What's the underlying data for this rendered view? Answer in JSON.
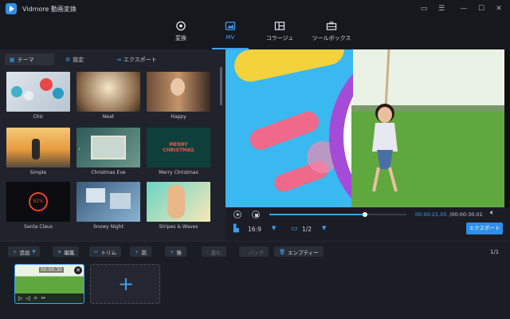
{
  "app": {
    "title": "Vidmore 動画変換"
  },
  "nav": [
    {
      "label": "変換",
      "icon": "convert-icon",
      "active": false
    },
    {
      "label": "MV",
      "icon": "mv-icon",
      "active": true
    },
    {
      "label": "コラージュ",
      "icon": "collage-icon",
      "active": false
    },
    {
      "label": "ツールボックス",
      "icon": "toolbox-icon",
      "active": false
    }
  ],
  "subtabs": [
    {
      "label": "テーマ",
      "icon": "grid-icon",
      "active": true
    },
    {
      "label": "設定",
      "icon": "gear-icon",
      "active": false
    },
    {
      "label": "エクスポート",
      "icon": "export-icon",
      "active": false
    }
  ],
  "themes": [
    {
      "name": "Chic"
    },
    {
      "name": "Neat"
    },
    {
      "name": "Happy"
    },
    {
      "name": "Simple"
    },
    {
      "name": "Christmas Eve"
    },
    {
      "name": "Merry Christmas"
    },
    {
      "name": "Santa Claus"
    },
    {
      "name": "Snowy Night"
    },
    {
      "name": "Stripes & Waves"
    }
  ],
  "theme_overlays": {
    "merry": "MERRY CHRISTMAS",
    "santa": "91%"
  },
  "player": {
    "time_current": "00:00:21.05",
    "time_total": "/00:00:30.01",
    "progress": 0.7,
    "aspect_ratio": "16:9",
    "screen": "1/2",
    "export_label": "エクスポート"
  },
  "toolbar": {
    "add": "追加",
    "edit": "編集",
    "trim": "トリム",
    "front": "前",
    "back": "後",
    "forward": "進む",
    "backward": "バック",
    "empty": "エンプティー",
    "page": "1/1"
  },
  "clip": {
    "duration": "00:00:30"
  },
  "colors": {
    "accent": "#3ea0f5",
    "export_button": "#2e8fea"
  }
}
